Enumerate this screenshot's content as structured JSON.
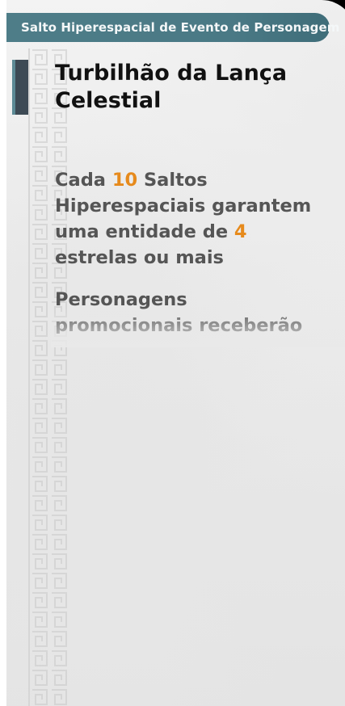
{
  "header": {
    "title": "Salto Hiperespacial de Evento de Personagem"
  },
  "character": {
    "name": "Turbilhão da Lança Celestial"
  },
  "info": {
    "pity_prefix": "Cada ",
    "pity_count": "10",
    "pity_middle": " Saltos Hiperespaciais garantem uma entidade de ",
    "pity_stars": "4",
    "pity_suffix": " estrelas ou mais",
    "promo_text": "Personagens promocionais receberão um aumento de"
  },
  "colors": {
    "header_bar": "#4e7d88",
    "highlight": "#e68a1c",
    "title_text": "#111111",
    "body_text": "#555555"
  }
}
